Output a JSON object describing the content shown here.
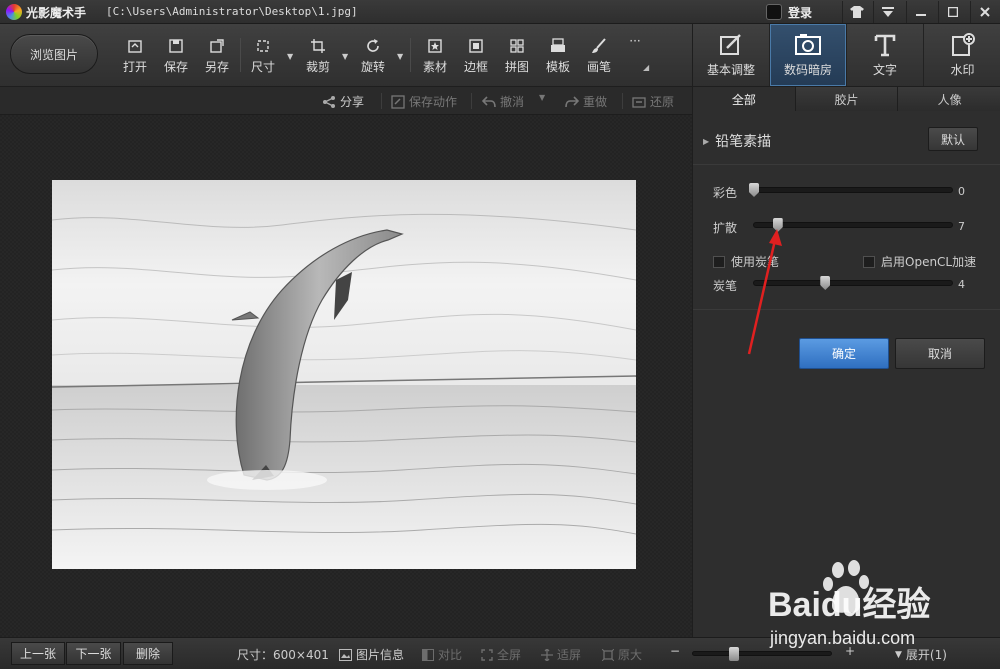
{
  "titlebar": {
    "app_name": "光影魔术手",
    "file_path": "[C:\\Users\\Administrator\\Desktop\\1.jpg]",
    "login": "登录"
  },
  "toolbar": {
    "browse": "浏览图片",
    "tools": [
      {
        "label": "打开",
        "icon": "open-icon"
      },
      {
        "label": "保存",
        "icon": "save-icon"
      },
      {
        "label": "另存",
        "icon": "save-as-icon"
      },
      {
        "label": "尺寸",
        "icon": "resize-icon"
      },
      {
        "label": "裁剪",
        "icon": "crop-icon"
      },
      {
        "label": "旋转",
        "icon": "rotate-icon"
      },
      {
        "label": "素材",
        "icon": "material-icon"
      },
      {
        "label": "边框",
        "icon": "border-icon"
      },
      {
        "label": "拼图",
        "icon": "collage-icon"
      },
      {
        "label": "模板",
        "icon": "template-icon"
      },
      {
        "label": "画笔",
        "icon": "brush-icon"
      },
      {
        "label": "···",
        "icon": "more-icon"
      }
    ]
  },
  "right_tabs": [
    {
      "label": "基本调整",
      "icon": "basic-adjust-icon"
    },
    {
      "label": "数码暗房",
      "icon": "darkroom-icon"
    },
    {
      "label": "文字",
      "icon": "text-icon"
    },
    {
      "label": "水印",
      "icon": "watermark-icon"
    }
  ],
  "actions": {
    "share": "分享",
    "save_action": "保存动作",
    "undo": "撤消",
    "redo": "重做",
    "restore": "还原"
  },
  "panel": {
    "subtabs": [
      "全部",
      "胶片",
      "人像"
    ],
    "effect_name": "铅笔素描",
    "default_btn": "默认",
    "sliders": [
      {
        "label": "彩色",
        "value": "0",
        "level": 0.0
      },
      {
        "label": "扩散",
        "value": "7",
        "level": 0.12
      },
      {
        "label": "炭笔",
        "value": "4",
        "level": 0.36
      }
    ],
    "use_charcoal": "使用炭笔",
    "opencl": "启用OpenCL加速",
    "ok": "确定",
    "cancel": "取消"
  },
  "statusbar": {
    "prev": "上一张",
    "next": "下一张",
    "delete": "删除",
    "size_label": "尺寸：600×401",
    "info": "图片信息",
    "compare": "对比",
    "fullscreen": "全屏",
    "fit": "适屏",
    "original": "原大",
    "zoom_minus": "−",
    "zoom_plus": "+",
    "zoom_level": 0.3,
    "expand": "展开(1)"
  },
  "watermark": {
    "brand": "Baidu经验",
    "url": "jingyan.baidu.com"
  },
  "colors": {
    "accent": "#3a7fd5",
    "arrow": "#e02020"
  }
}
